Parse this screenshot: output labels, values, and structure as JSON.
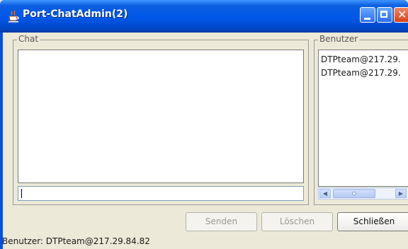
{
  "window": {
    "title": "Port-ChatAdmin(2)",
    "icon": "java-cup-icon",
    "controls": {
      "minimize": "minimize-icon",
      "maximize": "maximize-icon",
      "close": "close-icon"
    }
  },
  "chat": {
    "legend": "Chat",
    "messages": [],
    "input_value": ""
  },
  "users": {
    "legend": "Benutzer",
    "items": [
      "DTPteam@217.29.",
      "DTPteam@217.29."
    ]
  },
  "buttons": {
    "send": "Senden",
    "clear": "Löschen",
    "close": "Schließen"
  },
  "status": {
    "text": "Benutzer: DTPteam@217.29.84.82"
  },
  "colors": {
    "titlebar": "#0058e8",
    "window_bg": "#ece9d8",
    "close_button": "#d9401a"
  }
}
